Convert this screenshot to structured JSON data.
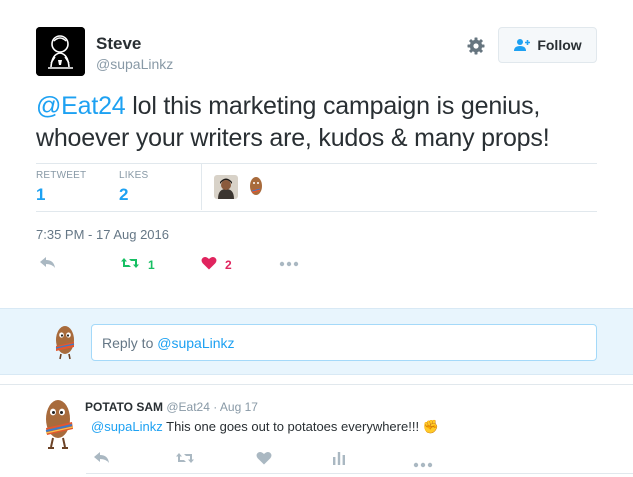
{
  "tweet": {
    "author_name": "Steve",
    "author_handle": "@supaLinkz",
    "follow_label": "Follow",
    "text_mention": "@Eat24",
    "text_body": " lol this marketing campaign is genius, whoever your writers are, kudos & many props!",
    "stats": {
      "retweet_label": "RETWEET",
      "retweet_count": "1",
      "likes_label": "LIKES",
      "likes_count": "2"
    },
    "timestamp": "7:35 PM - 17 Aug 2016",
    "actions": {
      "retweet_count": "1",
      "like_count": "2"
    }
  },
  "reply_box": {
    "prefix": "Reply to ",
    "mention": "@supaLinkz"
  },
  "reply_tweet": {
    "author_name": "POTATO SAM",
    "meta": "@Eat24 · Aug 17",
    "mention": "@supaLinkz",
    "text": " This one goes out to potatoes everywhere!!! ✊"
  },
  "colors": {
    "accent": "#1da1f2",
    "retweet_green": "#17bf63",
    "like_red": "#e0245e",
    "muted": "#8899a6"
  }
}
